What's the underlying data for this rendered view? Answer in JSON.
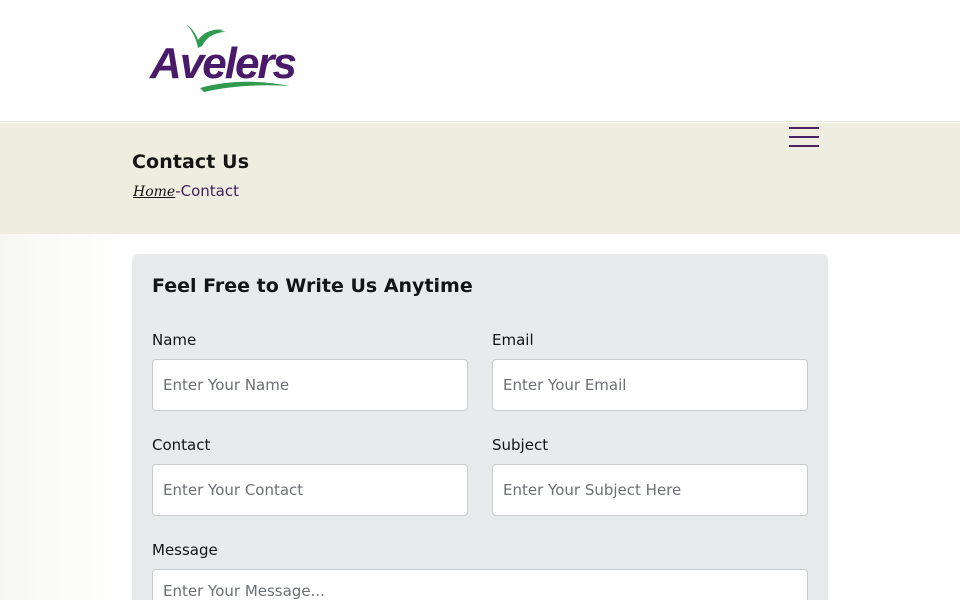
{
  "header": {
    "logo_text": "Avelers"
  },
  "banner": {
    "title": "Contact Us",
    "breadcrumb": {
      "home": "Home",
      "separator": "-",
      "current": "Contact"
    }
  },
  "form": {
    "heading": "Feel Free to Write Us Anytime",
    "fields": {
      "name": {
        "label": "Name",
        "placeholder": "Enter Your Name"
      },
      "email": {
        "label": "Email",
        "placeholder": "Enter Your Email"
      },
      "contact": {
        "label": "Contact",
        "placeholder": "Enter Your Contact"
      },
      "subject": {
        "label": "Subject",
        "placeholder": "Enter Your Subject Here"
      },
      "message": {
        "label": "Message",
        "placeholder": "Enter Your Message..."
      }
    }
  },
  "icons": {
    "menu": "hamburger-menu-icon",
    "logo_mark": "bird-icon"
  },
  "colors": {
    "brand_purple": "#4a1a6a",
    "brand_green": "#2e9a4e",
    "banner_bg": "#efede0",
    "card_bg": "#e8eaec"
  }
}
